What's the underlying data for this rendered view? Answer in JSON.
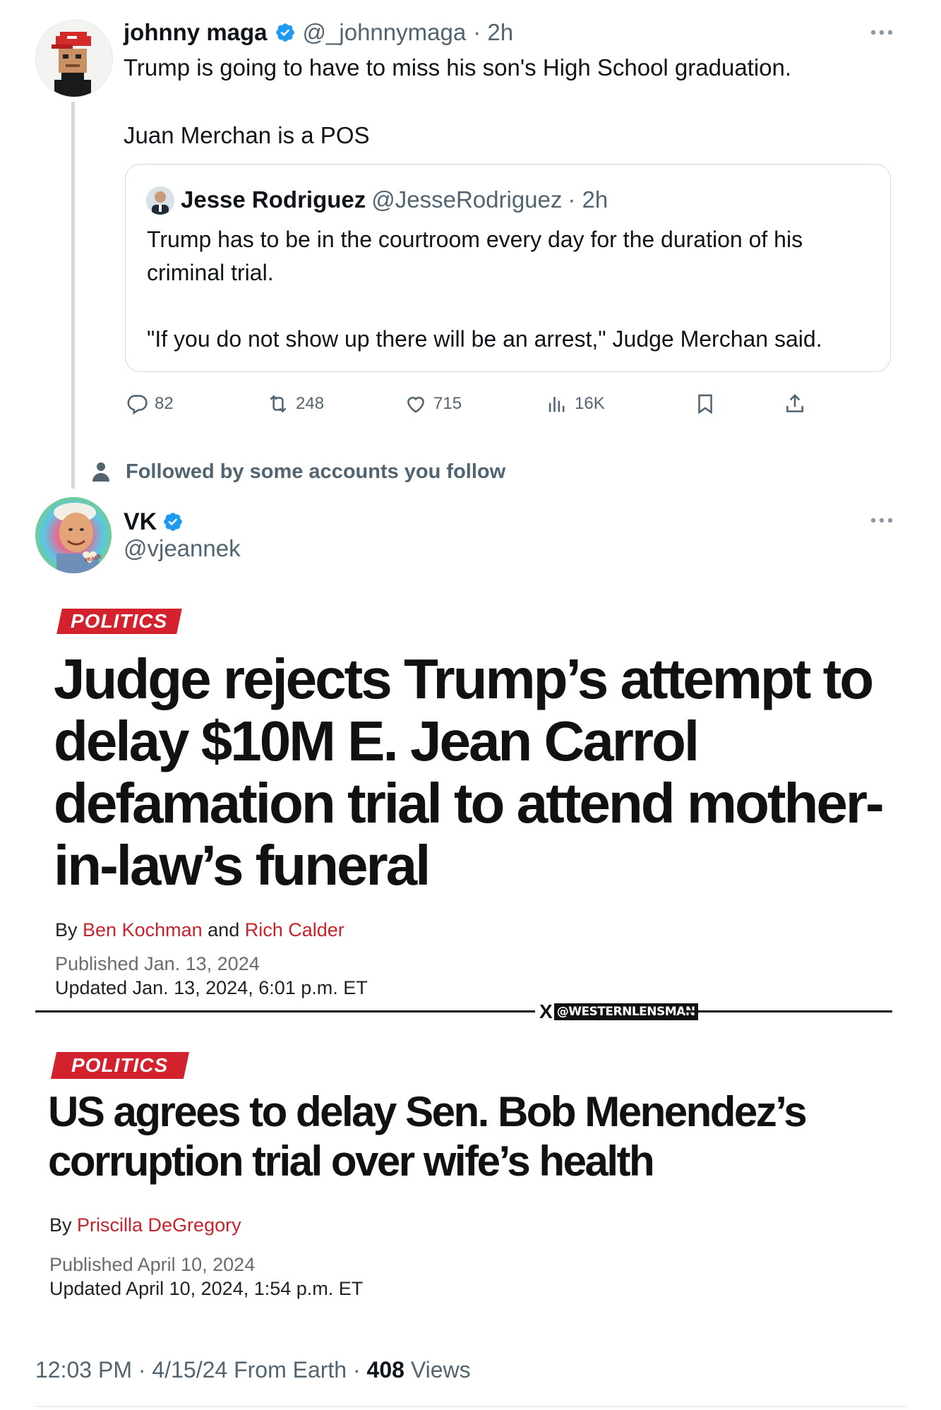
{
  "tweet_top": {
    "name": "johnny maga",
    "handle": "@_johnnymaga",
    "time": "· 2h",
    "text": "Trump is going to have to miss his son's High School graduation.\n\nJuan Merchan is a POS",
    "quote": {
      "name": "Jesse Rodriguez",
      "handle": "@JesseRodriguez",
      "time": "· 2h",
      "text": "Trump has to be in the courtroom every day for the duration of his criminal trial.\n\n\"If you do not show up there will be an arrest,\" Judge Merchan said."
    },
    "actions": {
      "replies": "82",
      "reposts": "248",
      "likes": "715",
      "views": "16K"
    }
  },
  "social_context": "Followed by some accounts you follow",
  "tweet_main": {
    "name": "VK",
    "handle": "@vjeannek",
    "avatar_badge": "PEACE",
    "article1": {
      "tag": "POLITICS",
      "headline": "Judge rejects Trump’s attempt to delay $10M E. Jean Carrol defamation trial to attend mother-in-law’s funeral",
      "by": "By",
      "author1": "Ben Kochman",
      "and": "and",
      "author2": "Rich Calder",
      "published": "Published Jan. 13, 2024",
      "updated": "Updated Jan. 13, 2024, 6:01 p.m. ET"
    },
    "watermark": {
      "x": "X",
      "label": "@WESTERNLENSMAN"
    },
    "article2": {
      "tag": "POLITICS",
      "headline": "US agrees to delay Sen. Bob Menendez’s corruption trial over wife’s health",
      "by": "By",
      "author1": "Priscilla DeGregory",
      "published": "Published April 10, 2024",
      "updated": "Updated April 10, 2024, 1:54 p.m. ET"
    },
    "footer": {
      "time": "12:03 PM · 4/15/24 From Earth · ",
      "views_count": "408",
      "views_label": " Views"
    }
  },
  "colors": {
    "accent_blue": "#1d9bf0",
    "tag_red": "#d4212e",
    "author_red": "#c8232c",
    "secondary_text": "#536471"
  }
}
